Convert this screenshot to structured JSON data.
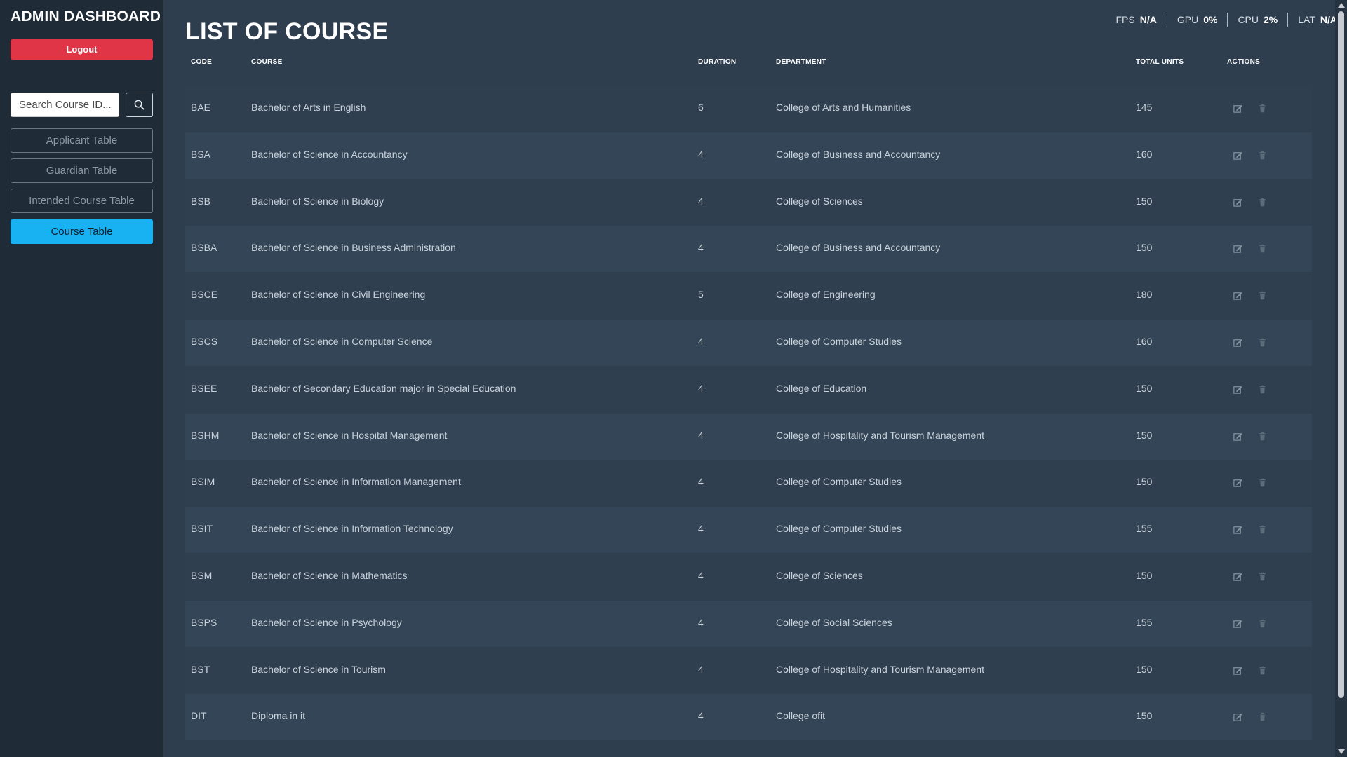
{
  "sidebar": {
    "title": "ADMIN DASHBOARD",
    "logout_label": "Logout",
    "search_placeholder": "Search Course ID...",
    "nav": [
      {
        "label": "Applicant Table",
        "active": false
      },
      {
        "label": "Guardian Table",
        "active": false
      },
      {
        "label": "Intended Course Table",
        "active": false
      },
      {
        "label": "Course Table",
        "active": true
      }
    ]
  },
  "main": {
    "title": "LIST OF COURSE"
  },
  "stats": [
    {
      "label": "FPS",
      "value": "N/A"
    },
    {
      "label": "GPU",
      "value": "0%"
    },
    {
      "label": "CPU",
      "value": "2%"
    },
    {
      "label": "LAT",
      "value": "N/A"
    }
  ],
  "table": {
    "headers": [
      "CODE",
      "COURSE",
      "DURATION",
      "DEPARTMENT",
      "TOTAL UNITS",
      "ACTIONS"
    ],
    "rows": [
      {
        "code": "BAE",
        "course": "Bachelor of Arts in English",
        "duration": "6",
        "department": "College of Arts and Humanities",
        "units": "145"
      },
      {
        "code": "BSA",
        "course": "Bachelor of Science in Accountancy",
        "duration": "4",
        "department": "College of Business and Accountancy",
        "units": "160"
      },
      {
        "code": "BSB",
        "course": "Bachelor of Science in Biology",
        "duration": "4",
        "department": "College of Sciences",
        "units": "150"
      },
      {
        "code": "BSBA",
        "course": "Bachelor of Science in Business Administration",
        "duration": "4",
        "department": "College of Business and Accountancy",
        "units": "150"
      },
      {
        "code": "BSCE",
        "course": "Bachelor of Science in Civil Engineering",
        "duration": "5",
        "department": "College of Engineering",
        "units": "180"
      },
      {
        "code": "BSCS",
        "course": "Bachelor of Science in Computer Science",
        "duration": "4",
        "department": "College of Computer Studies",
        "units": "160"
      },
      {
        "code": "BSEE",
        "course": "Bachelor of Secondary Education major in Special Education",
        "duration": "4",
        "department": "College of Education",
        "units": "150"
      },
      {
        "code": "BSHM",
        "course": "Bachelor of Science in Hospital Management",
        "duration": "4",
        "department": "College of Hospitality and Tourism Management",
        "units": "150"
      },
      {
        "code": "BSIM",
        "course": "Bachelor of Science in Information Management",
        "duration": "4",
        "department": "College of Computer Studies",
        "units": "150"
      },
      {
        "code": "BSIT",
        "course": "Bachelor of Science in Information Technology",
        "duration": "4",
        "department": "College of Computer Studies",
        "units": "155"
      },
      {
        "code": "BSM",
        "course": "Bachelor of Science in Mathematics",
        "duration": "4",
        "department": "College of Sciences",
        "units": "150"
      },
      {
        "code": "BSPS",
        "course": "Bachelor of Science in Psychology",
        "duration": "4",
        "department": "College of Social Sciences",
        "units": "155"
      },
      {
        "code": "BST",
        "course": "Bachelor of Science in Tourism",
        "duration": "4",
        "department": "College of Hospitality and Tourism Management",
        "units": "150"
      },
      {
        "code": "DIT",
        "course": "Diploma in it",
        "duration": "4",
        "department": "College ofit",
        "units": "150"
      }
    ]
  },
  "icons": {
    "search": "search-icon",
    "edit": "edit-icon",
    "delete": "trash-icon"
  },
  "colors": {
    "logout": "#e03447",
    "active_nav": "#18b1f2",
    "background": "#2e3e4e",
    "sidebar": "#1f2b37"
  }
}
